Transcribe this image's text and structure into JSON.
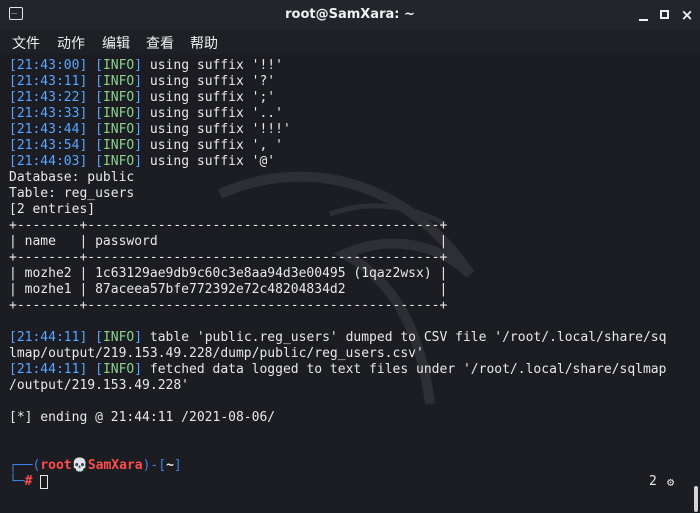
{
  "window": {
    "title": "root@SamXara: ~",
    "buttons": {
      "minimize": "—",
      "maximize": "□",
      "close": "×"
    }
  },
  "menu": {
    "items": [
      "文件",
      "动作",
      "编辑",
      "查看",
      "帮助"
    ]
  },
  "terminal": {
    "suffix_lines": [
      {
        "time": "21:43:00",
        "level": "INFO",
        "text": " using suffix '!!'"
      },
      {
        "time": "21:43:11",
        "level": "INFO",
        "text": " using suffix '?'"
      },
      {
        "time": "21:43:22",
        "level": "INFO",
        "text": " using suffix ';'"
      },
      {
        "time": "21:43:33",
        "level": "INFO",
        "text": " using suffix '..'"
      },
      {
        "time": "21:43:44",
        "level": "INFO",
        "text": " using suffix '!!!'"
      },
      {
        "time": "21:43:54",
        "level": "INFO",
        "text": " using suffix ', '"
      },
      {
        "time": "21:44:03",
        "level": "INFO",
        "text": " using suffix '@'"
      }
    ],
    "database": "Database: public",
    "table": "Table: reg_users",
    "entries": "[2 entries]",
    "table_border": "+--------+---------------------------------------------+",
    "table_header": "| name   | password                                    |",
    "rows": [
      "| mozhe2 | 1c63129ae9db9c60c3e8aa94d3e00495 (1qaz2wsx) |",
      "| mozhe1 | 87aceea57bfe772392e72c48204834d2            |"
    ],
    "dump_line1": {
      "time": "21:44:11",
      "level": "INFO",
      "text": " table 'public.reg_users' dumped to CSV file '/root/.local/share/sq"
    },
    "dump_line2": "lmap/output/219.153.49.228/dump/public/reg_users.csv'",
    "fetch_line1": {
      "time": "21:44:11",
      "level": "INFO",
      "text": " fetched data logged to text files under '/root/.local/share/sqlmap"
    },
    "fetch_line2": "/output/219.153.49.228'",
    "ending": "[*] ending @ 21:44:11 /2021-08-06/",
    "prompt": {
      "user": "root",
      "skull": "💀",
      "host": "SamXara",
      "path": "~",
      "symbol": "#"
    },
    "status_count": "2"
  }
}
